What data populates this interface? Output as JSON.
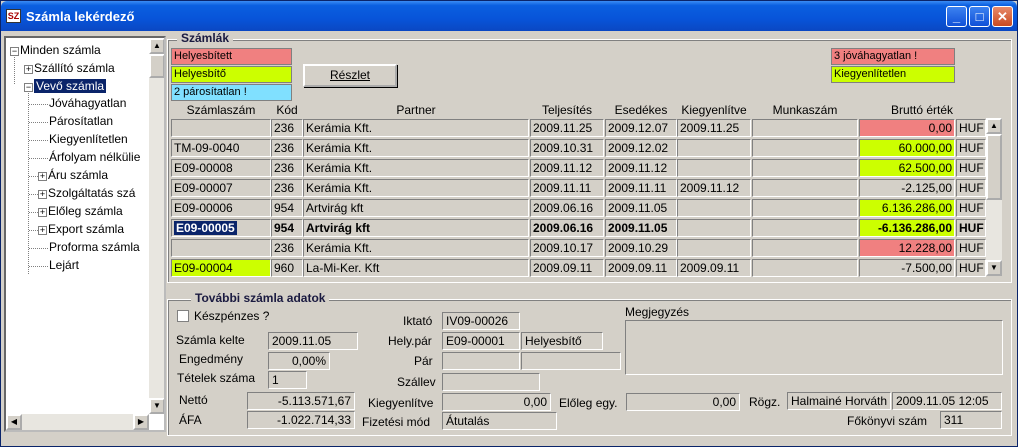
{
  "window": {
    "title": "Számla lekérdező",
    "icon": "app-icon",
    "min": "_",
    "max": "□",
    "close": "✕"
  },
  "tree": [
    {
      "label": "Minden számla",
      "exp": "−"
    },
    {
      "label": "Szállító számla",
      "exp": "+"
    },
    {
      "label": "Vevő számla",
      "exp": "−",
      "selected": true
    },
    {
      "label": "Jóváhagyatlan"
    },
    {
      "label": "Párosítatlan"
    },
    {
      "label": "Kiegyenlítetlen"
    },
    {
      "label": "Árfolyam nélkülie"
    },
    {
      "label": "Áru számla",
      "exp": "+"
    },
    {
      "label": "Szolgáltatás szá",
      "exp": "+"
    },
    {
      "label": "Előleg számla",
      "exp": "+"
    },
    {
      "label": "Export számla",
      "exp": "+"
    },
    {
      "label": "Proforma számla"
    },
    {
      "label": "Lejárt"
    }
  ],
  "invoices": {
    "group_title": "Számlák",
    "legend_left": [
      {
        "label": "Helyesbített",
        "color": "#f08080"
      },
      {
        "label": "Helyesbítő",
        "color": "#ccff00"
      },
      {
        "label": "2 párosítatlan !",
        "color": "#80e0ff"
      }
    ],
    "legend_right": [
      {
        "label": "3 jóváhagyatlan !",
        "color": "#f08080"
      },
      {
        "label": "Kiegyenlítetlen",
        "color": "#ccff00"
      }
    ],
    "detail_button": "Részlet",
    "columns": [
      "Számlaszám",
      "Kód",
      "Partner",
      "Teljesítés",
      "Esedékes",
      "Kiegyenlítve",
      "Munkaszám",
      "Bruttó érték"
    ],
    "rows": [
      {
        "num": "",
        "kod": "236",
        "partner": "Kerámia Kft.",
        "telj": "2009.11.25",
        "esed": "2009.12.07",
        "kiegy": "2009.11.25",
        "munka": "",
        "brutto": "0,00",
        "cur": "HUF",
        "color": "#f08080"
      },
      {
        "num": "TM-09-0040",
        "kod": "236",
        "partner": "Kerámia Kft.",
        "telj": "2009.10.31",
        "esed": "2009.12.02",
        "kiegy": "",
        "munka": "",
        "brutto": "60.000,00",
        "cur": "HUF",
        "color": "#ccff00"
      },
      {
        "num": "E09-00008",
        "kod": "236",
        "partner": "Kerámia Kft.",
        "telj": "2009.11.12",
        "esed": "2009.11.12",
        "kiegy": "",
        "munka": "",
        "brutto": "62.500,00",
        "cur": "HUF",
        "color": "#ccff00"
      },
      {
        "num": "E09-00007",
        "kod": "236",
        "partner": "Kerámia Kft.",
        "telj": "2009.11.11",
        "esed": "2009.11.11",
        "kiegy": "2009.11.12",
        "munka": "",
        "brutto": "-2.125,00",
        "cur": "HUF",
        "color": ""
      },
      {
        "num": "E09-00006",
        "kod": "954",
        "partner": "Artvirág kft",
        "telj": "2009.06.16",
        "esed": "2009.11.05",
        "kiegy": "",
        "munka": "",
        "brutto": "6.136.286,00",
        "cur": "HUF",
        "color": "#ccff00"
      },
      {
        "num": "E09-00005",
        "kod": "954",
        "partner": "Artvirág kft",
        "telj": "2009.06.16",
        "esed": "2009.11.05",
        "kiegy": "",
        "munka": "",
        "brutto": "-6.136.286,00",
        "cur": "HUF",
        "color": "#ccff00",
        "current": true
      },
      {
        "num": "",
        "kod": "236",
        "partner": "Kerámia Kft.",
        "telj": "2009.10.17",
        "esed": "2009.10.29",
        "kiegy": "",
        "munka": "",
        "brutto": "12.228,00",
        "cur": "HUF",
        "color": "#f08080"
      },
      {
        "num": "E09-00004",
        "kod": "960",
        "partner": "La-Mi-Ker. Kft",
        "telj": "2009.09.11",
        "esed": "2009.09.11",
        "kiegy": "2009.09.11",
        "munka": "",
        "brutto": "-7.500,00",
        "cur": "HUF",
        "color": "",
        "num_color": "#ccff00"
      }
    ]
  },
  "details": {
    "group_title": "További számla adatok",
    "cash_label": "Készpénzes ?",
    "kelte_label": "Számla kelte",
    "kelte": "2009.11.05",
    "engedmeny_label": "Engedmény",
    "engedmeny": "0,00%",
    "tetelek_label": "Tételek száma",
    "tetelek": "1",
    "netto_label": "Nettó",
    "netto": "-5.113.571,67",
    "afa_label": "ÁFA",
    "afa": "-1.022.714,33",
    "iktato_label": "Iktató",
    "iktato": "IV09-00026",
    "helypar_label": "Hely.pár",
    "helypar_num": "E09-00001",
    "helypar_type": "Helyesbítő",
    "par_label": "Pár",
    "par1": "",
    "par2": "",
    "szallev_label": "Szállev",
    "szallev": "",
    "kiegy_label": "Kiegyenlítve",
    "kiegy": "0,00",
    "fizmod_label": "Fizetési mód",
    "fizmod": "Átutalás",
    "eloleg_label": "Előleg egy.",
    "eloleg": "0,00",
    "megj_label": "Megjegyzés",
    "megj": "",
    "rogz_label": "Rögz.",
    "rogz_user": "Halmainé Horváth",
    "rogz_time": "2009.11.05 12:05",
    "fokonyv_label": "Főkönyvi szám",
    "fokonyv": "311"
  }
}
